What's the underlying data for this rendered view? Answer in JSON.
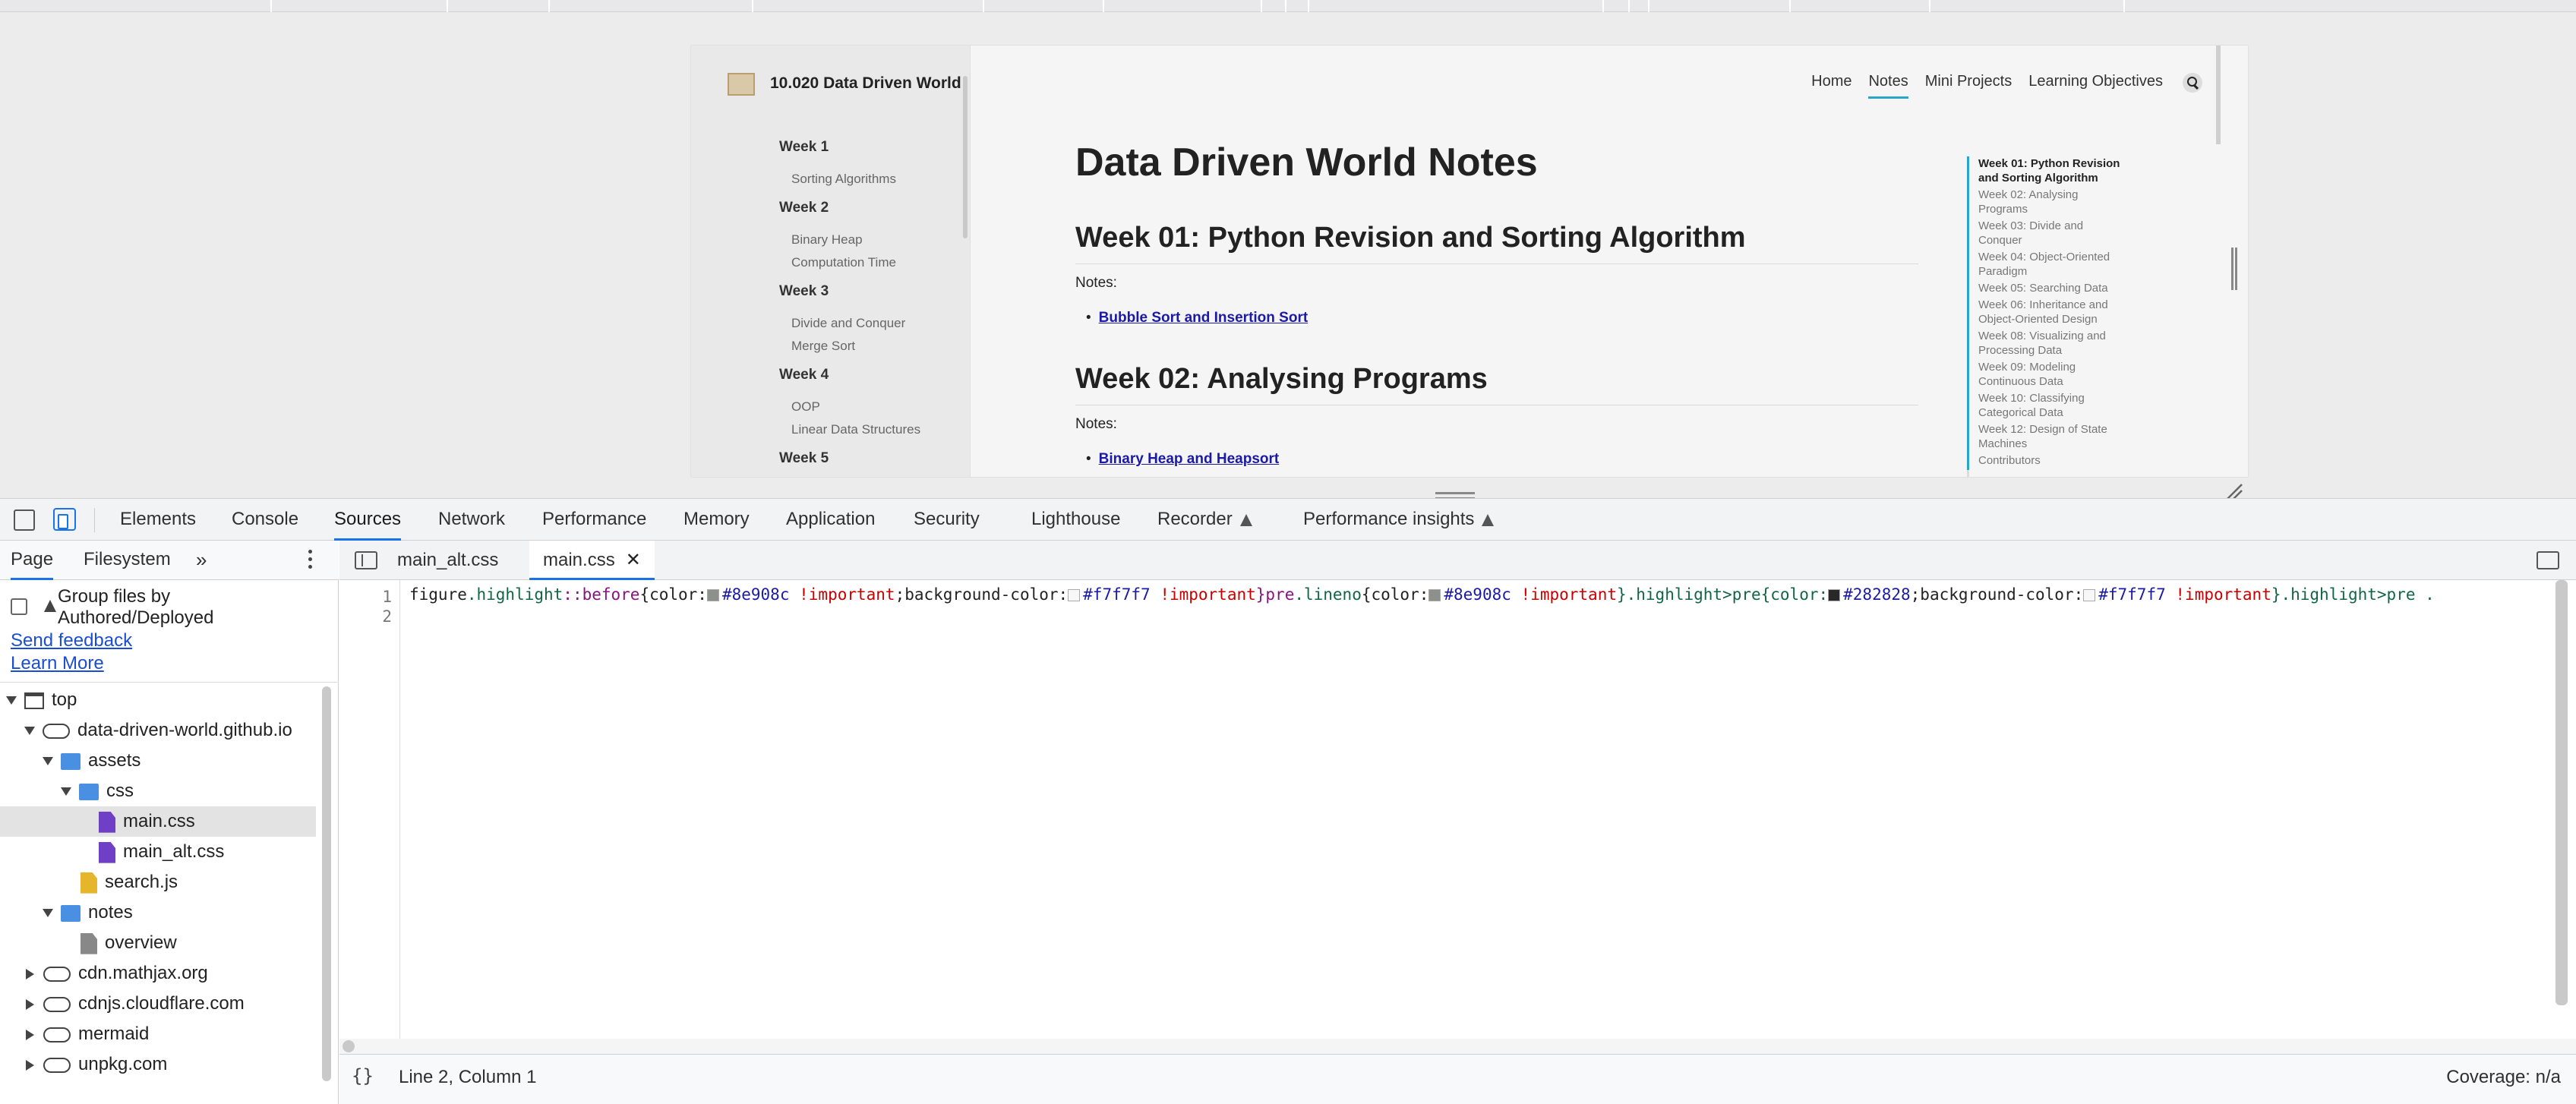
{
  "site": {
    "title": "10.020 Data Driven World",
    "nav": [
      "Home",
      "Notes",
      "Mini Projects",
      "Learning Objectives"
    ],
    "sidebar": [
      {
        "week": "Week 1",
        "items": [
          "Sorting Algorithms"
        ]
      },
      {
        "week": "Week 2",
        "items": [
          "Binary Heap",
          "Computation Time"
        ]
      },
      {
        "week": "Week 3",
        "items": [
          "Divide and Conquer",
          "Merge Sort"
        ]
      },
      {
        "week": "Week 4",
        "items": [
          "OOP",
          "Linear Data Structures"
        ]
      },
      {
        "week": "Week 5",
        "items": []
      }
    ],
    "heading": "Data Driven World Notes",
    "sections": [
      {
        "title": "Week 01: Python Revision and Sorting Algorithm",
        "notes_label": "Notes:",
        "link": "Bubble Sort and Insertion Sort"
      },
      {
        "title": "Week 02: Analysing Programs",
        "notes_label": "Notes:",
        "link": "Binary Heap and Heapsort"
      }
    ],
    "toc": [
      "Week 01: Python Revision and Sorting Algorithm",
      "Week 02: Analysing Programs",
      "Week 03: Divide and Conquer",
      "Week 04: Object-Oriented Paradigm",
      "Week 05: Searching Data",
      "Week 06: Inheritance and Object-Oriented Design",
      "Week 08: Visualizing and Processing Data",
      "Week 09: Modeling Continuous Data",
      "Week 10: Classifying Categorical Data",
      "Week 12: Design of State Machines",
      "Contributors"
    ]
  },
  "devtools": {
    "tabs": [
      "Elements",
      "Console",
      "Sources",
      "Network",
      "Performance",
      "Memory",
      "Application",
      "Security",
      "Lighthouse",
      "Recorder",
      "Performance insights"
    ],
    "active_tab": "Sources",
    "navigator": {
      "tabs": [
        "Page",
        "Filesystem"
      ],
      "group_label": "Group files by Authored/Deployed",
      "send_feedback": "Send feedback",
      "learn_more": "Learn More",
      "tree": [
        {
          "label": "top",
          "icon": "frame-icon",
          "level": 0,
          "open": true
        },
        {
          "label": "data-driven-world.github.io",
          "icon": "cloud-icon",
          "level": 1,
          "open": true
        },
        {
          "label": "assets",
          "icon": "folder-icon",
          "level": 2,
          "open": true
        },
        {
          "label": "css",
          "icon": "folder-icon",
          "level": 3,
          "open": true
        },
        {
          "label": "main.css",
          "icon": "css-file-icon",
          "level": 4,
          "selected": true
        },
        {
          "label": "main_alt.css",
          "icon": "css-file-icon",
          "level": 4
        },
        {
          "label": "search.js",
          "icon": "js-file-icon",
          "level": 3
        },
        {
          "label": "notes",
          "icon": "folder-icon",
          "level": 2,
          "open": true
        },
        {
          "label": "overview",
          "icon": "document-icon",
          "level": 3
        },
        {
          "label": "cdn.mathjax.org",
          "icon": "cloud-icon",
          "level": 1,
          "open": false
        },
        {
          "label": "cdnjs.cloudflare.com",
          "icon": "cloud-icon",
          "level": 1,
          "open": false
        },
        {
          "label": "mermaid",
          "icon": "cloud-icon",
          "level": 1,
          "open": false
        },
        {
          "label": "unpkg.com",
          "icon": "cloud-icon",
          "level": 1,
          "open": false
        }
      ]
    },
    "editor": {
      "tabs": [
        "main_alt.css",
        "main.css"
      ],
      "active_tab": "main.css",
      "line_numbers": [
        "1",
        "2"
      ],
      "code": {
        "p1": "figure",
        "p2": ".highlight",
        "p3": "::before",
        "p4": "{color:",
        "c1": "#8e908c",
        "imp": "!important",
        "p5": ";background-color:",
        "c2": "#f7f7f7",
        "p6": "}pre",
        "p7": ".lineno",
        "p8": "}.highlight>pre{color:",
        "c3": "#282828",
        "p9": "}.highlight>pre ."
      },
      "swatches": {
        "gray": "#8e908c",
        "light": "#f7f7f7",
        "dark": "#282828"
      },
      "cursor": "Line 2, Column 1",
      "coverage": "Coverage: n/a",
      "pretty_print": "{}"
    }
  },
  "colors": {
    "accent": "#1a73e8",
    "site_accent": "#2aa6c9",
    "link": "#1a1aa6"
  }
}
